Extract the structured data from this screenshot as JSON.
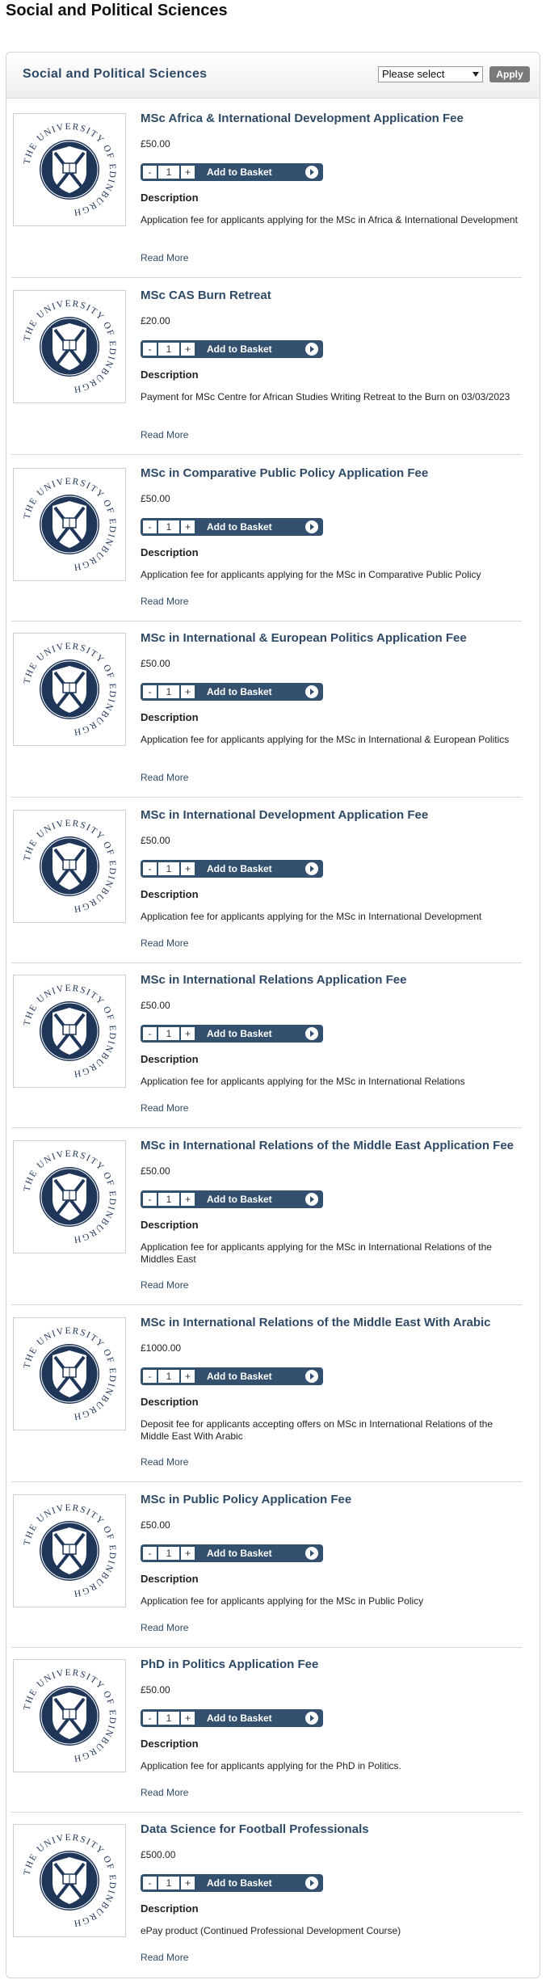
{
  "page": {
    "heading": "Social and Political Sciences"
  },
  "panel": {
    "title": "Social and Political Sciences",
    "select_value": "Please select",
    "apply_label": "Apply"
  },
  "labels": {
    "add_to_basket": "Add to Basket",
    "description": "Description",
    "read_more": "Read More",
    "minus": "-",
    "plus": "+",
    "qty": "1"
  },
  "brand": {
    "accent": "#2f4a66",
    "button": "#33506e",
    "crest": "#1f3659"
  },
  "crest": {
    "ring_text": "THE UNIVERSITY OF EDINBURGH"
  },
  "products": [
    {
      "title": "MSc Africa & International Development Application Fee",
      "price": "£50.00",
      "description": "Application fee for applicants applying for the MSc in Africa & International Development"
    },
    {
      "title": "MSc CAS Burn Retreat",
      "price": "£20.00",
      "description": "Payment for MSc Centre for African Studies Writing Retreat to the Burn on 03/03/2023"
    },
    {
      "title": "MSc in Comparative Public Policy Application Fee",
      "price": "£50.00",
      "description": "Application fee for applicants applying for the MSc in Comparative Public Policy"
    },
    {
      "title": "MSc in International & European Politics Application Fee",
      "price": "£50.00",
      "description": "Application fee for applicants applying for the MSc in International & European Politics"
    },
    {
      "title": "MSc in International Development Application Fee",
      "price": "£50.00",
      "description": "Application fee for applicants applying for the MSc in International Development"
    },
    {
      "title": "MSc in International Relations Application Fee",
      "price": "£50.00",
      "description": "Application fee for applicants applying for the MSc in International Relations"
    },
    {
      "title": "MSc in International Relations of the Middle East Application Fee",
      "price": "£50.00",
      "description": "Application fee for applicants applying for the MSc in International Relations of the Middles East"
    },
    {
      "title": "MSc in International Relations of the Middle East With Arabic",
      "price": "£1000.00",
      "description": "Deposit fee for applicants accepting offers on MSc in International Relations of the Middle East With Arabic"
    },
    {
      "title": "MSc in Public Policy Application Fee",
      "price": "£50.00",
      "description": "Application fee for applicants applying for the MSc in Public Policy"
    },
    {
      "title": "PhD in Politics Application Fee",
      "price": "£50.00",
      "description": "Application fee for applicants applying for the PhD in Politics."
    },
    {
      "title": "Data Science for Football Professionals",
      "price": "£500.00",
      "description": "ePay product (Continued Professional Development Course)"
    }
  ]
}
